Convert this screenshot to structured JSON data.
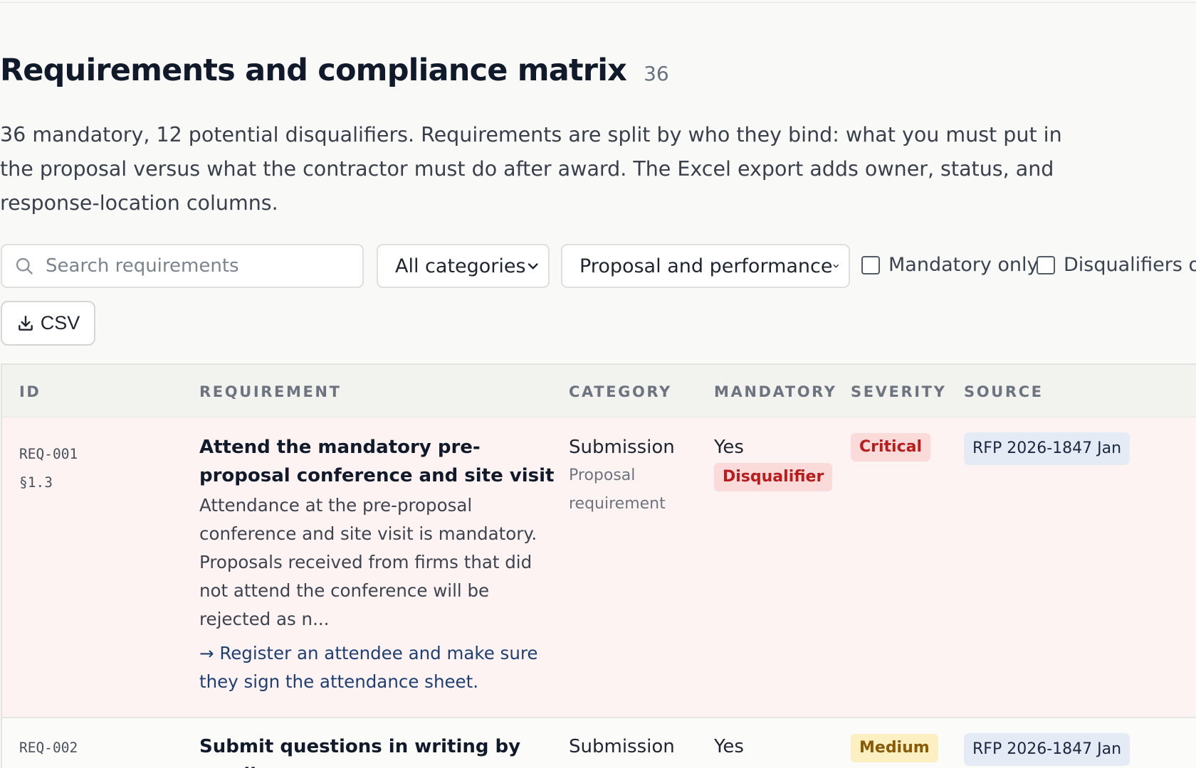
{
  "header": {
    "title": "Requirements and compliance matrix",
    "count": "36",
    "description": "36 mandatory, 12 potential disqualifiers. Requirements are split by who they bind: what you must put in the proposal versus what the contractor must do after award. The Excel export adds owner, status, and response-location columns."
  },
  "filters": {
    "search_placeholder": "Search requirements",
    "category_selected": "All categories",
    "scope_selected": "Proposal and performance",
    "mandatory_only_label": "Mandatory only",
    "mandatory_only_checked": false,
    "disqualifiers_only_label": "Disqualifiers on",
    "disqualifiers_only_checked": false,
    "csv_label": "CSV"
  },
  "table": {
    "columns": [
      "ID",
      "REQUIREMENT",
      "CATEGORY",
      "MANDATORY",
      "SEVERITY",
      "SOURCE"
    ],
    "rows": [
      {
        "id": "REQ-001",
        "section": "§1.3",
        "title": "Attend the mandatory pre-proposal conference and site visit",
        "body": "Attendance at the pre-proposal conference and site visit is mandatory. Proposals received from firms that did not attend the conference will be rejected as n...",
        "action": "→ Register an attendee and make sure they sign the attendance sheet.",
        "category": "Submission",
        "category_sub": "Proposal requirement",
        "mandatory": "Yes",
        "disqualifier": "Disqualifier",
        "severity": "Critical",
        "source": "RFP 2026-1847 Jan"
      },
      {
        "id": "REQ-002",
        "title": "Submit questions in writing by email",
        "category": "Submission",
        "mandatory": "Yes",
        "severity": "Medium",
        "source": "RFP 2026-1847 Jan"
      }
    ]
  },
  "colors": {
    "critical": "#b91c1c",
    "medium": "#8a5a07",
    "disqualifier_row_bg": "#fdf3f2"
  }
}
